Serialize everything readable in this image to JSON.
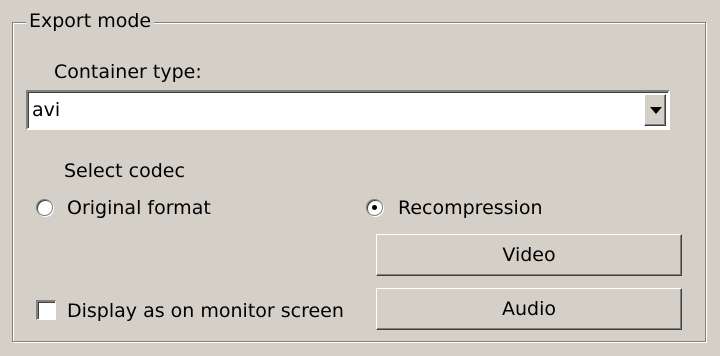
{
  "group": {
    "title": "Export mode"
  },
  "container": {
    "label": "Container type:",
    "value": "avi"
  },
  "codec": {
    "label": "Select codec",
    "options": [
      {
        "label": "Original format",
        "checked": false
      },
      {
        "label": "Recompression",
        "checked": true
      }
    ]
  },
  "buttons": {
    "video": "Video",
    "audio": "Audio"
  },
  "display": {
    "label": "Display as on monitor screen",
    "checked": false
  },
  "icons": {
    "dropdown": "chevron-down-icon",
    "radio": "radio-icon",
    "checkbox": "checkbox-icon"
  },
  "colors": {
    "background": "#d4d0c8",
    "field": "#ffffff",
    "shadow": "#808080"
  }
}
